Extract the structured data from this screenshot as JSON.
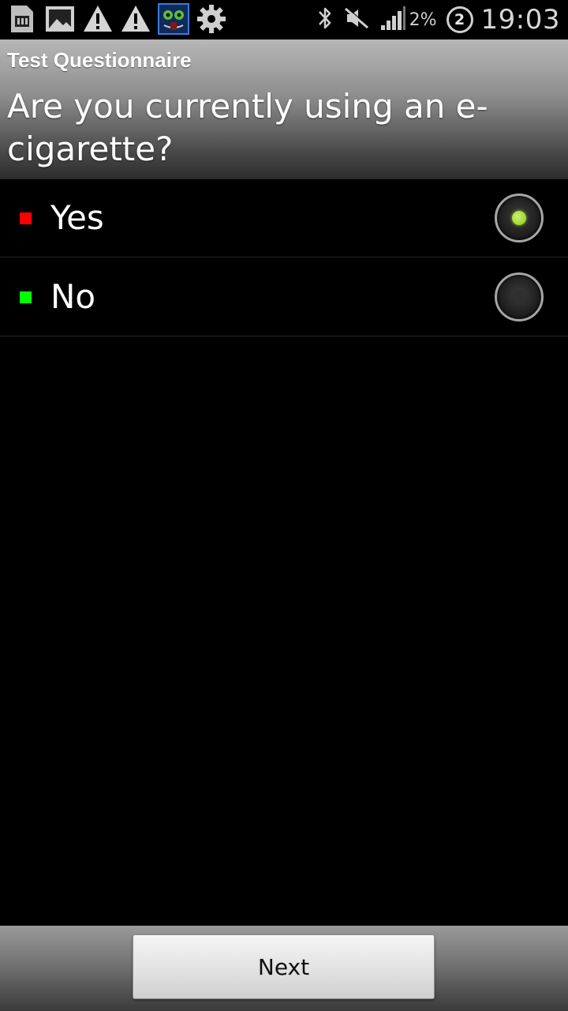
{
  "status_bar": {
    "left_icons": [
      "sd-card-icon",
      "gallery-icon",
      "warning-icon",
      "warning-icon",
      "app-face-icon",
      "settings-icon"
    ],
    "right_icons": [
      "bluetooth-icon",
      "mute-icon",
      "signal-icon"
    ],
    "battery": "2%",
    "notification_count": "2",
    "time": "19:03"
  },
  "header": {
    "app_title": "Test Questionnaire",
    "question": "Are you currently using an e-cigarette?"
  },
  "options": [
    {
      "label": "Yes",
      "color": "#ff0000",
      "selected": true
    },
    {
      "label": "No",
      "color": "#00ff00",
      "selected": false
    }
  ],
  "footer": {
    "next_label": "Next"
  },
  "colors": {
    "selected_radio": "#9be02a"
  }
}
